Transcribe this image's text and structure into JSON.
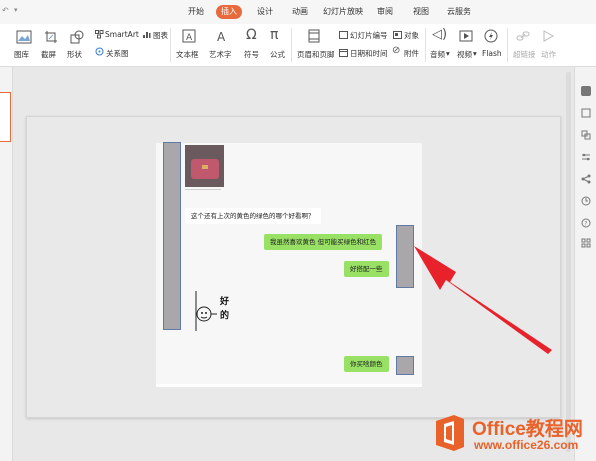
{
  "tabs": [
    "开始",
    "插入",
    "设计",
    "动画",
    "幻灯片放映",
    "审阅",
    "视图",
    "云服务"
  ],
  "active_tab": "插入",
  "ribbon": {
    "smartart": "SmartArt",
    "chart": "图表",
    "picture": "图库",
    "screenshot": "截屏",
    "shape": "形状",
    "relation": "关系图",
    "textbox": "文本框",
    "wordart": "艺术字",
    "symbol": "符号",
    "formula": "公式",
    "header_footer": "页眉和页脚",
    "slide_number": "幻灯片编号",
    "object": "对象",
    "datetime": "日期和时间",
    "attachment": "附件",
    "audio": "音频",
    "video": "视频",
    "flash": "Flash",
    "hyperlink": "超链接",
    "action": "动作"
  },
  "chat": {
    "msg_question": "这个还有上次的黄色的绿色的哪个好看啊？",
    "msg_reply1": "我虽然喜欢黄色 但可能买绿色和红色",
    "msg_reply2": "好搭配一些",
    "msg_reply3": "你买啥颜色",
    "sticker_text_1": "好",
    "sticker_text_2": "的"
  },
  "watermark": {
    "brand": "Office教程网",
    "url": "www.office26.com"
  },
  "colors": {
    "accent": "#e86a3c",
    "bubble_green": "#98e165",
    "arrow_red": "#e8222a"
  }
}
